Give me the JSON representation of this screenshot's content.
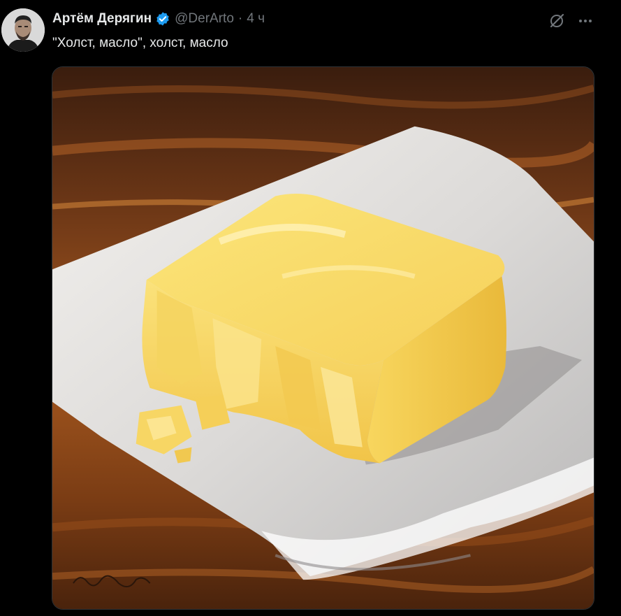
{
  "tweet": {
    "author_name": "Артём Дерягин",
    "handle": "@DerArto",
    "separator": "·",
    "time": "4 ч",
    "text": "\"Холст, масло\", холст, масло",
    "verified_icon": "verified-badge-icon",
    "accent_color": "#1d9bf0"
  },
  "actions": {
    "grok_icon": "grok-icon",
    "more_icon": "more-dots-icon"
  },
  "media": {
    "subject": "oil painting of a block of butter on a white cloth on a wooden table",
    "signature": "J.Ingl ..."
  }
}
